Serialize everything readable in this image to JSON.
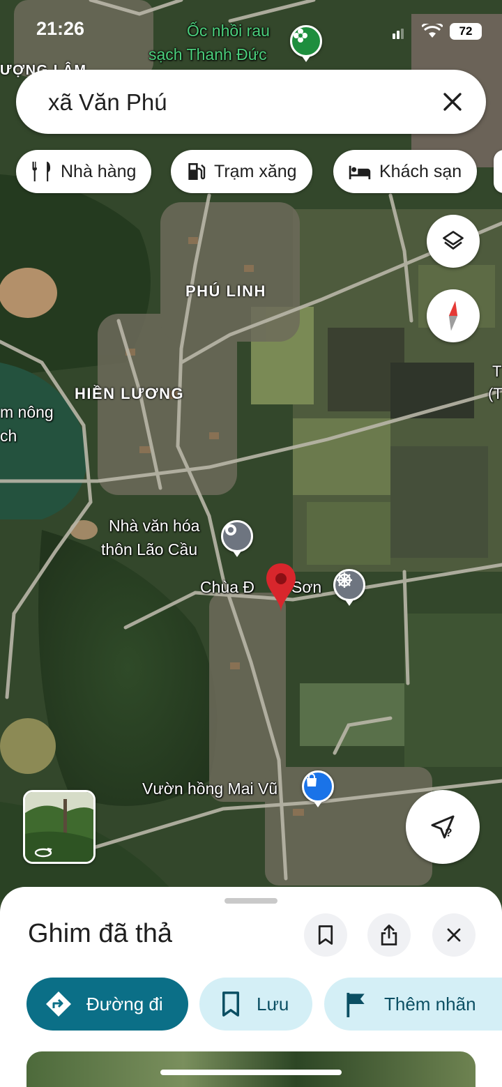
{
  "status_bar": {
    "time": "21:26",
    "battery": "72"
  },
  "search": {
    "query": "xã Văn Phú"
  },
  "chips": [
    {
      "label": "Nhà hàng",
      "icon": "restaurant-icon"
    },
    {
      "label": "Trạm xăng",
      "icon": "gas-station-icon"
    },
    {
      "label": "Khách sạn",
      "icon": "hotel-icon"
    }
  ],
  "map": {
    "areas": [
      "PHÚ LINH",
      "HIỀN LƯƠNG"
    ],
    "pois": {
      "oc": {
        "line1": "Ốc nhồi rau",
        "line2": "sạch Thanh Đức"
      },
      "nvh": {
        "line1": "Nhà văn hóa",
        "line2": "thôn Lão Cầu"
      },
      "chua": "Chùa Đ",
      "chua_tail": "Sơn",
      "vuon": "Vườn hồng Mai Vũ"
    },
    "edge_labels": {
      "top_left": "ƯỢNG LÂM",
      "left_1": "m nông",
      "left_2": "ch",
      "right_1": "T",
      "right_2": "(T"
    },
    "accent_colors": {
      "pin_red": "#d8262c",
      "poi_green": "#1e8e3e",
      "poi_blue": "#1a73e8",
      "poi_gray": "#6e7580"
    }
  },
  "sheet": {
    "title": "Ghim đã thả",
    "actions": {
      "directions": "Đường đi",
      "save": "Lưu",
      "label": "Thêm nhãn"
    },
    "accent": "#0b6f87"
  }
}
